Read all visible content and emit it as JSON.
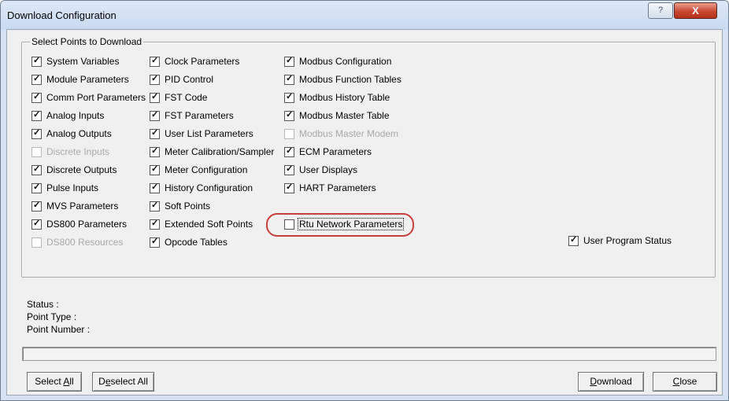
{
  "window": {
    "title": "Download Configuration",
    "help_glyph": "?",
    "close_glyph": "X"
  },
  "group": {
    "label": "Select Points to Download"
  },
  "columns": [
    {
      "items": [
        {
          "label": "System Variables",
          "checked": true,
          "enabled": true
        },
        {
          "label": "Module Parameters",
          "checked": true,
          "enabled": true
        },
        {
          "label": "Comm Port Parameters",
          "checked": true,
          "enabled": true
        },
        {
          "label": "Analog Inputs",
          "checked": true,
          "enabled": true
        },
        {
          "label": "Analog Outputs",
          "checked": true,
          "enabled": true
        },
        {
          "label": "Discrete Inputs",
          "checked": false,
          "enabled": false
        },
        {
          "label": "Discrete Outputs",
          "checked": true,
          "enabled": true
        },
        {
          "label": "Pulse Inputs",
          "checked": true,
          "enabled": true
        },
        {
          "label": "MVS Parameters",
          "checked": true,
          "enabled": true
        },
        {
          "label": "DS800 Parameters",
          "checked": true,
          "enabled": true
        },
        {
          "label": "DS800 Resources",
          "checked": false,
          "enabled": false
        }
      ]
    },
    {
      "items": [
        {
          "label": "Clock Parameters",
          "checked": true,
          "enabled": true
        },
        {
          "label": "PID Control",
          "checked": true,
          "enabled": true
        },
        {
          "label": "FST Code",
          "checked": true,
          "enabled": true
        },
        {
          "label": "FST Parameters",
          "checked": true,
          "enabled": true
        },
        {
          "label": "User List Parameters",
          "checked": true,
          "enabled": true
        },
        {
          "label": "Meter Calibration/Sampler",
          "checked": true,
          "enabled": true
        },
        {
          "label": "Meter Configuration",
          "checked": true,
          "enabled": true
        },
        {
          "label": "History Configuration",
          "checked": true,
          "enabled": true
        },
        {
          "label": "Soft Points",
          "checked": true,
          "enabled": true
        },
        {
          "label": "Extended Soft Points",
          "checked": true,
          "enabled": true
        },
        {
          "label": "Opcode Tables",
          "checked": true,
          "enabled": true
        }
      ]
    },
    {
      "items": [
        {
          "label": "Modbus Configuration",
          "checked": true,
          "enabled": true
        },
        {
          "label": "Modbus Function Tables",
          "checked": true,
          "enabled": true
        },
        {
          "label": "Modbus History Table",
          "checked": true,
          "enabled": true
        },
        {
          "label": "Modbus Master Table",
          "checked": true,
          "enabled": true
        },
        {
          "label": "Modbus Master Modem",
          "checked": false,
          "enabled": false
        },
        {
          "label": "ECM Parameters",
          "checked": true,
          "enabled": true
        },
        {
          "label": "User Displays",
          "checked": true,
          "enabled": true
        },
        {
          "label": "HART Parameters",
          "checked": true,
          "enabled": true
        },
        {
          "label": "",
          "checked": false,
          "enabled": true
        },
        {
          "label": "Rtu Network Parameters",
          "checked": false,
          "enabled": true,
          "focused": true,
          "highlighted": true
        }
      ]
    }
  ],
  "user_program_status": {
    "label": "User Program Status",
    "checked": true,
    "enabled": true
  },
  "status": {
    "status_label": "Status :",
    "point_type_label": "Point Type :",
    "point_number_label": "Point Number :"
  },
  "buttons": {
    "select_all": {
      "pre": "Select ",
      "accel": "A",
      "post": "ll"
    },
    "deselect_all": {
      "pre": "D",
      "accel": "e",
      "post": "select All"
    },
    "download": {
      "pre": "",
      "accel": "D",
      "post": "ownload"
    },
    "close": {
      "pre": "",
      "accel": "C",
      "post": "lose"
    }
  },
  "colors": {
    "highlight_ring": "#c8403a",
    "close_button": "#c9472f"
  }
}
